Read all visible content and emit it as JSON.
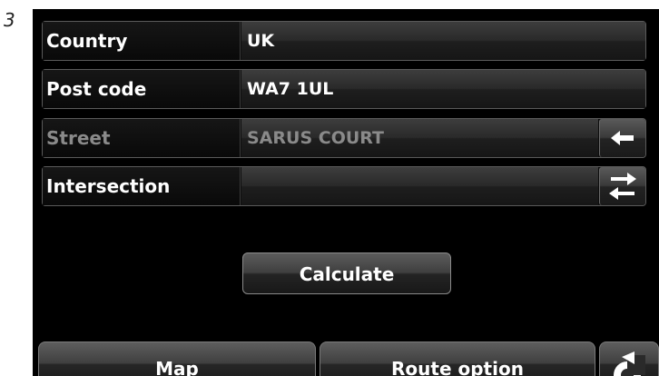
{
  "figure_number": "3",
  "fields": [
    {
      "label": "Country",
      "value": "UK",
      "enabled": true
    },
    {
      "label": "Post code",
      "value": "WA7 1UL",
      "enabled": true
    },
    {
      "label": "Street",
      "value": "SARUS COURT",
      "enabled": false,
      "side_icon": "left-arrow-icon"
    },
    {
      "label": "Intersection",
      "value": "",
      "enabled": true,
      "side_icon": "swap-arrows-icon"
    }
  ],
  "actions": {
    "calculate_label": "Calculate"
  },
  "bottom_bar": {
    "map_label": "Map",
    "route_option_label": "Route option",
    "back_icon": "back-icon"
  },
  "colors": {
    "background": "#000000",
    "text": "#ffffff",
    "disabled_text": "#8a8a8a"
  }
}
